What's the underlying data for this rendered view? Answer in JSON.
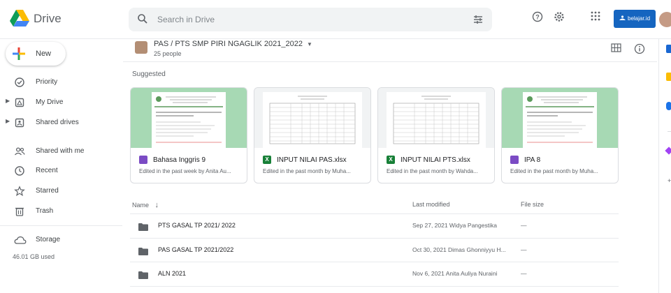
{
  "app": {
    "name": "Drive"
  },
  "search": {
    "placeholder": "Search in Drive"
  },
  "account": {
    "badge_label": "belajar.id"
  },
  "sidebar": {
    "new_label": "New",
    "items": [
      {
        "label": "Priority",
        "icon": "priority-icon"
      },
      {
        "label": "My Drive",
        "icon": "my-drive-icon"
      },
      {
        "label": "Shared drives",
        "icon": "shared-drives-icon"
      },
      {
        "label": "Shared with me",
        "icon": "shared-with-me-icon"
      },
      {
        "label": "Recent",
        "icon": "clock-icon"
      },
      {
        "label": "Starred",
        "icon": "star-icon"
      },
      {
        "label": "Trash",
        "icon": "trash-icon"
      }
    ],
    "storage": {
      "label": "Storage",
      "used": "46.01 GB used"
    }
  },
  "main": {
    "folder_title": "PAS / PTS SMP PIRI NGAGLIK 2021_2022",
    "folder_members": "25 people",
    "suggested_label": "Suggested",
    "suggested": [
      {
        "title": "Bahasa Inggris 9",
        "subtitle": "Edited in the past week by Anita Au...",
        "type": "slides"
      },
      {
        "title": "INPUT NILAI PAS.xlsx",
        "subtitle": "Edited in the past month by Muha...",
        "type": "sheet"
      },
      {
        "title": "INPUT NILAI PTS.xlsx",
        "subtitle": "Edited in the past month by Wahda...",
        "type": "sheet"
      },
      {
        "title": "IPA 8",
        "subtitle": "Edited in the past month by Muha...",
        "type": "slides"
      }
    ],
    "list": {
      "headers": {
        "name": "Name",
        "modified": "Last modified",
        "size": "File size"
      },
      "rows": [
        {
          "name": "PTS GASAL TP 2021/ 2022",
          "modified": "Sep 27, 2021  Widya Pangestika",
          "size": "—"
        },
        {
          "name": "PAS GASAL TP 2021/2022",
          "modified": "Oct 30, 2021  Dimas Ghonniyyu H...",
          "size": "—"
        },
        {
          "name": "ALN 2021",
          "modified": "Nov 6, 2021  Anita Auliya Nuraini",
          "size": "—"
        }
      ]
    }
  },
  "colors": {
    "accent": "#1a73e8",
    "folder": "#5f6368",
    "slides": "#7b4bc4",
    "sheets": "#188038",
    "preview_green": "#a7d9b4"
  }
}
